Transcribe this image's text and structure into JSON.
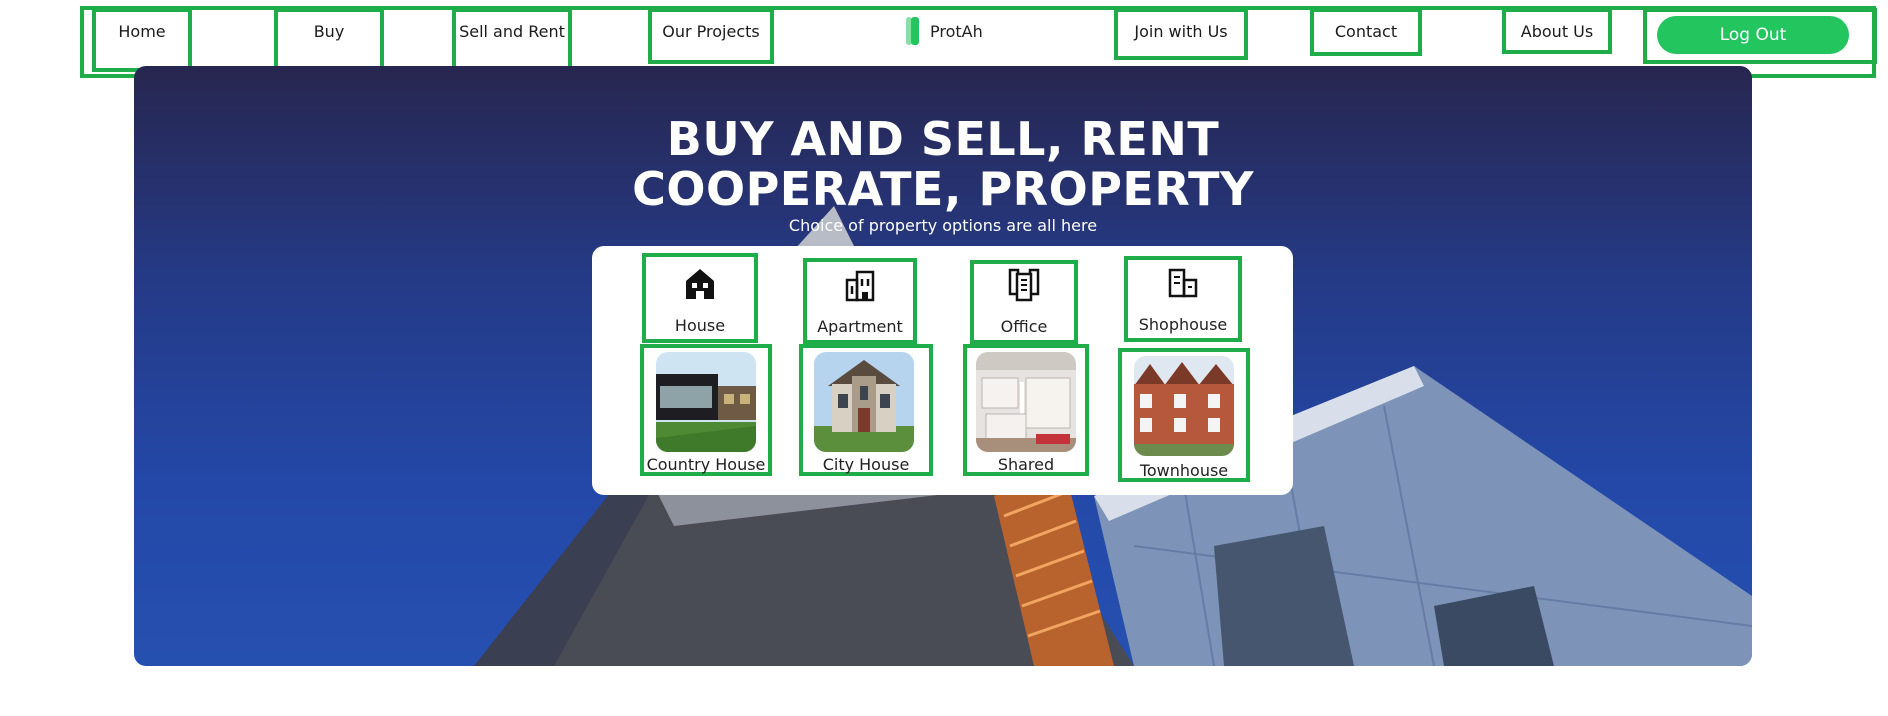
{
  "nav": {
    "home": "Home",
    "buy": "Buy",
    "sell_rent": "Sell and Rent",
    "projects": "Our Projects",
    "brand": "ProtAh",
    "join": "Join with Us",
    "contact": "Contact",
    "about": "About Us",
    "logout": "Log Out"
  },
  "hero": {
    "title_line1": "BUY AND SELL, RENT",
    "title_line2": "COOPERATE, PROPERTY",
    "subtitle": "Choice of property options are all here"
  },
  "categories": [
    {
      "label": "House",
      "icon": "house-icon"
    },
    {
      "label": "Apartment",
      "icon": "apartment-icon"
    },
    {
      "label": "Office",
      "icon": "office-icon"
    },
    {
      "label": "Shophouse",
      "icon": "shophouse-icon"
    }
  ],
  "property_types": [
    {
      "label": "Country House"
    },
    {
      "label": "City House"
    },
    {
      "label": "Shared"
    },
    {
      "label": "Townhouse"
    }
  ],
  "colors": {
    "accent": "#22c55e",
    "annotation": "#1fad4a",
    "hero_top": "#27264f",
    "hero_bottom": "#2650b0"
  }
}
